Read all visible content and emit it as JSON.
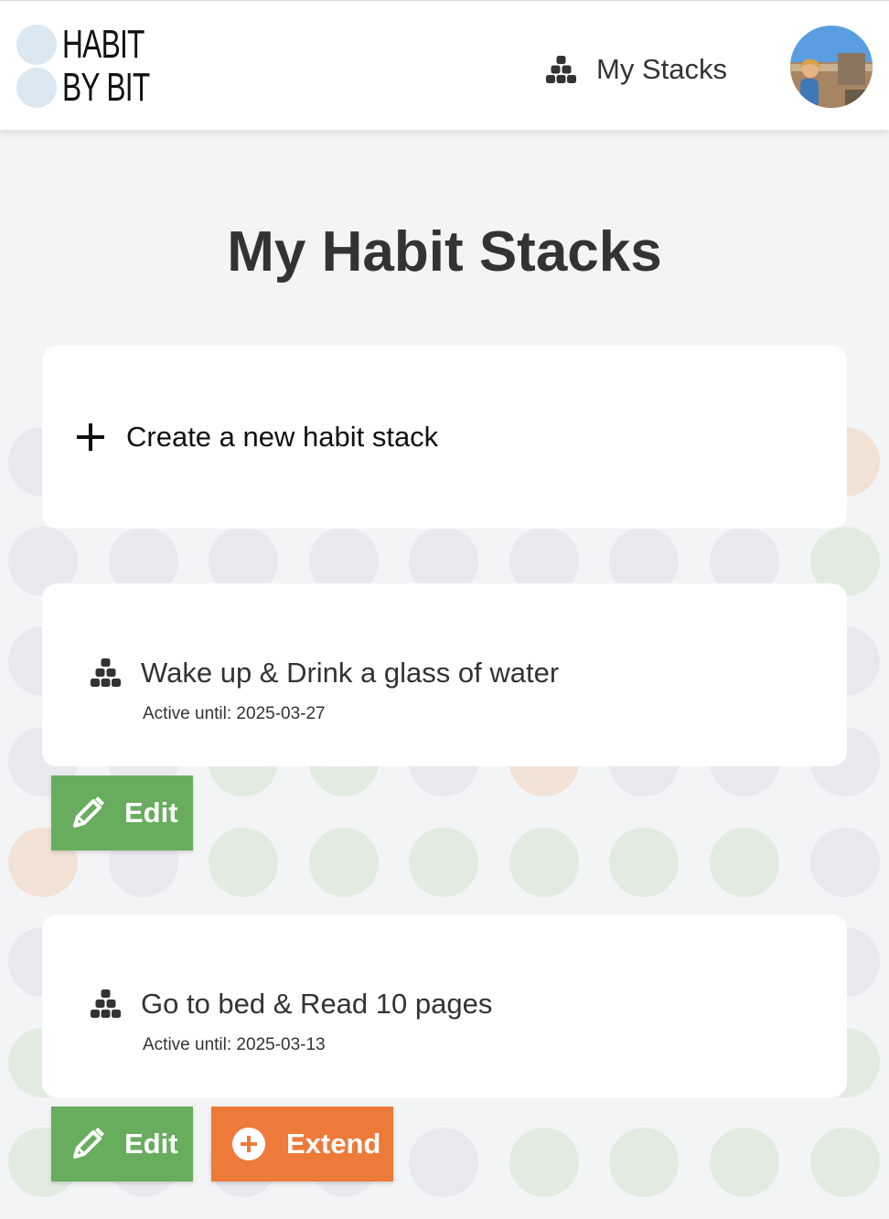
{
  "header": {
    "logo_line1": "HABIT",
    "logo_line2": "BY BIT",
    "nav_label": "My Stacks"
  },
  "page_title": "My Habit Stacks",
  "create_card": {
    "label": "Create a new habit stack"
  },
  "stacks": [
    {
      "title": "Wake up & Drink a glass of water",
      "active_until": "Active until: 2025-03-27",
      "actions": [
        "Edit"
      ]
    },
    {
      "title": "Go to bed & Read 10 pages",
      "active_until": "Active until: 2025-03-13",
      "actions": [
        "Edit",
        "Extend"
      ]
    }
  ],
  "buttons": {
    "edit": "Edit",
    "extend": "Extend"
  },
  "colors": {
    "edit": "#68ad5e",
    "extend": "#ee7a3a",
    "background": "#f3f4f6",
    "logo_circle": "#dbe8f2"
  },
  "icons": {
    "nav": "stack-icon",
    "create": "plus-icon",
    "stack": "stack-icon",
    "edit": "pencil-icon",
    "extend": "plus-circle-icon"
  }
}
